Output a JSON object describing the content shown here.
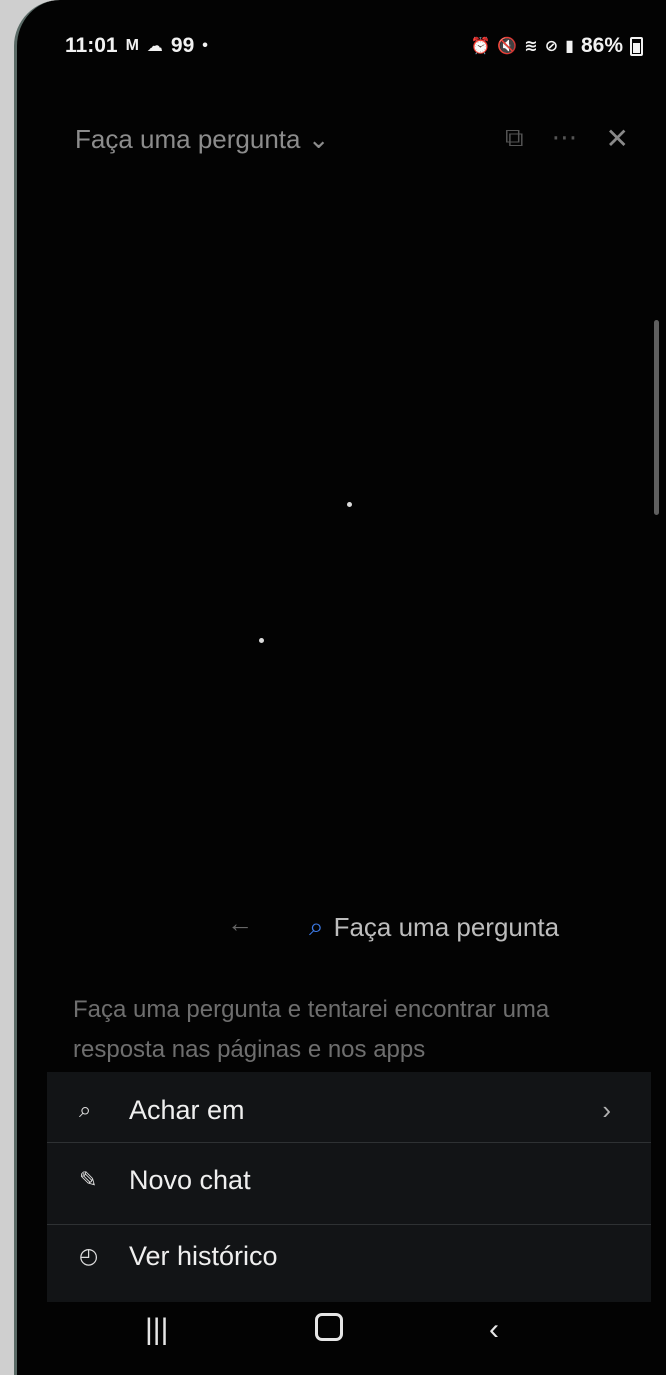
{
  "status_bar": {
    "time": "11:01",
    "notif_count": "99",
    "battery": "86%",
    "icons": [
      "gmail-icon",
      "cloud-icon",
      "alarm-icon",
      "mute-icon",
      "wifi-icon",
      "dnd-icon",
      "volte-icon",
      "signal-icon",
      "battery-icon"
    ]
  },
  "header": {
    "title": "Faça uma pergunta",
    "title_chevron": "⌄",
    "close": "✕"
  },
  "search": {
    "back": "←",
    "label": "Faça uma pergunta"
  },
  "description": "Faça uma pergunta e tentarei encontrar uma resposta nas páginas e nos apps",
  "menu": {
    "items": [
      {
        "label": "Achar em",
        "icon": "search-icon",
        "chevron": "›"
      },
      {
        "label": "Novo chat",
        "icon": "edit-icon"
      },
      {
        "label": "Ver histórico",
        "icon": "history-icon"
      }
    ]
  },
  "colors": {
    "accent": "#3d7be8",
    "background": "#030303",
    "menu_bg": "#121416"
  }
}
